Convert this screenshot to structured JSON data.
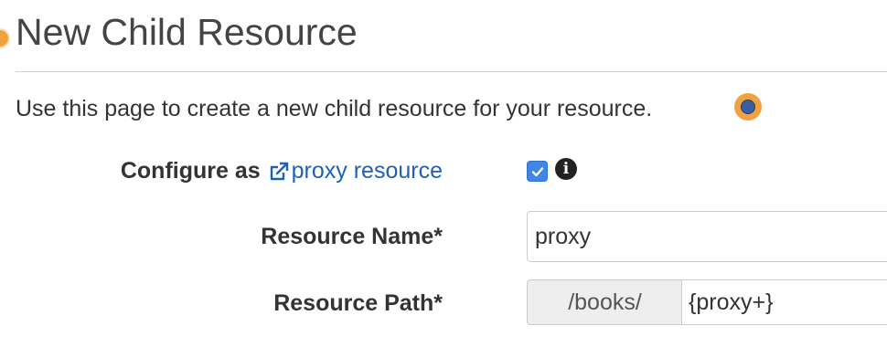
{
  "page": {
    "title": "New Child Resource",
    "intro": "Use this page to create a new child resource for your resource."
  },
  "form": {
    "configure": {
      "label": "Configure as",
      "link_text": "proxy resource",
      "checked": true,
      "link_icon": "external-link-icon",
      "info_icon": "info-icon"
    },
    "resource_name": {
      "label": "Resource Name*",
      "value": "proxy"
    },
    "resource_path": {
      "label": "Resource Path*",
      "prefix": "/books/",
      "value": "{proxy+}"
    }
  },
  "colors": {
    "link": "#1f62b5",
    "checkbox": "#3f86e6",
    "highlight_marker": "#f0a241",
    "marker_center": "#3b5f9e"
  }
}
